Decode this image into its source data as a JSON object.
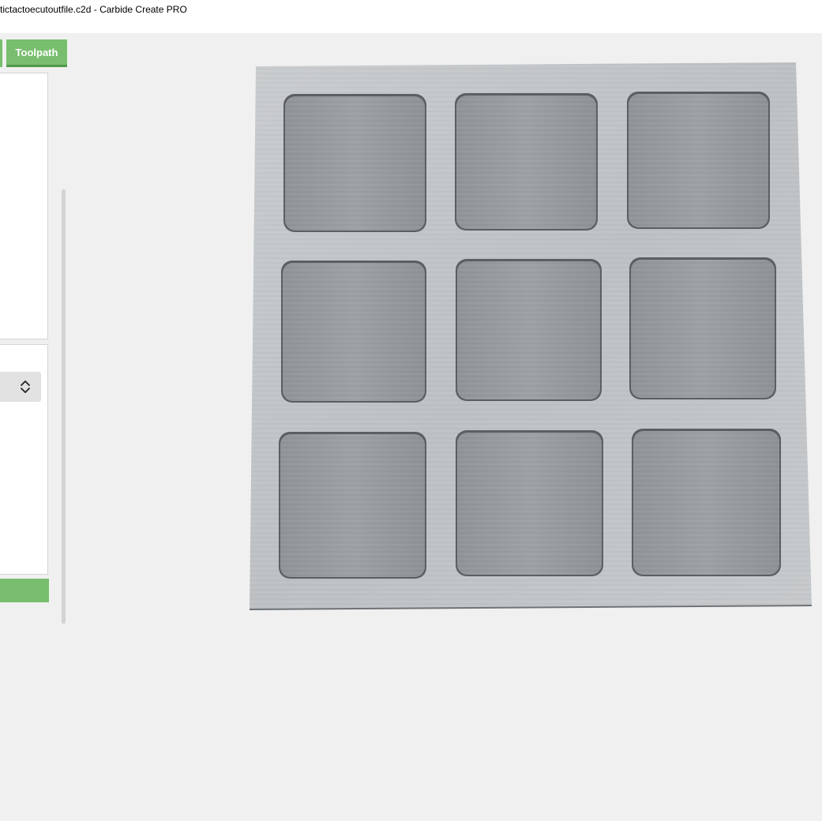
{
  "window": {
    "title": "tictactoecutoutfile.c2d - Carbide Create PRO"
  },
  "tabs": {
    "toolpath_label": "Toolpath"
  },
  "colors": {
    "accent_green": "#78be6e",
    "accent_green_dark": "#4f9a49",
    "background": "#f0f0f0",
    "stock_light": "#c4c7ca",
    "pocket_gray": "#8f9397"
  },
  "icons": {
    "select_arrows": "updown-chevron-icon"
  },
  "preview": {
    "description_hidden": true,
    "grid_rows": 3,
    "grid_cols": 3
  }
}
